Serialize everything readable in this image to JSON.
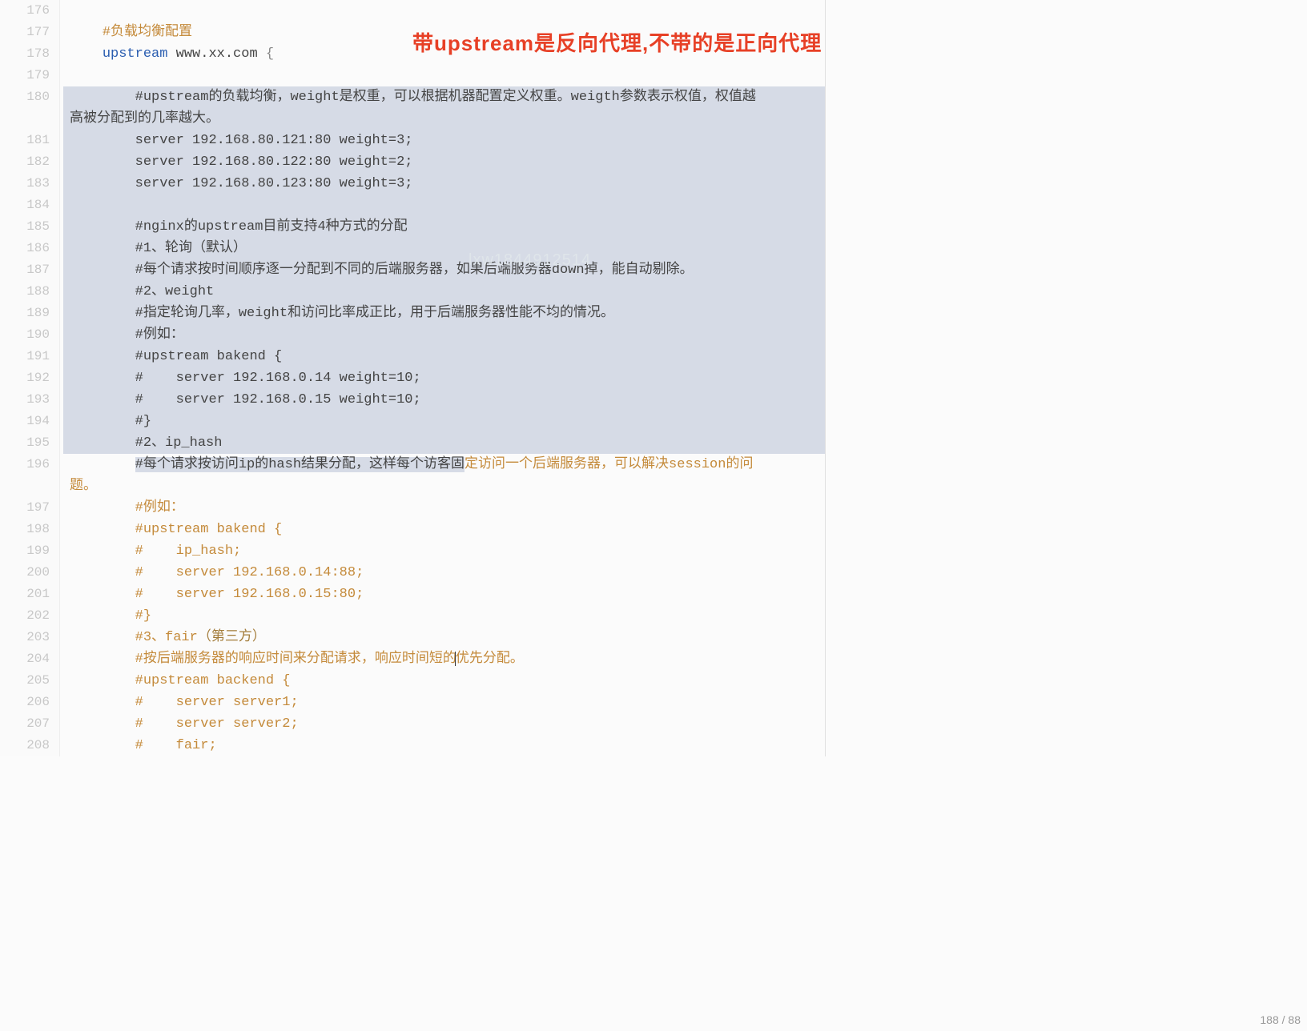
{
  "annotation": "带upstream是反向代理,不带的是正向代理",
  "watermark": "lxw1844912514",
  "status": "188 / 88",
  "gutter_start": 176,
  "lines": {
    "l176": "",
    "l177_a": "#负载均衡配置",
    "l178_kw": "upstream",
    "l178_host": " www.xx.com ",
    "l178_brace": "{",
    "l179": "",
    "l180_a": "#upstream的负载均衡，weight是权重，可以根据机器配置定义权重。weigth参数表示权值，权值越",
    "l180_b": "高被分配到的几率越大。",
    "l181": "server 192.168.80.121:80 weight=3;",
    "l182": "server 192.168.80.122:80 weight=2;",
    "l183": "server 192.168.80.123:80 weight=3;",
    "l184": "",
    "l185": "#nginx的upstream目前支持4种方式的分配",
    "l186": "#1、轮询（默认）",
    "l187": "#每个请求按时间顺序逐一分配到不同的后端服务器，如果后端服务器down掉，能自动剔除。",
    "l188": "#2、weight",
    "l189": "#指定轮询几率，weight和访问比率成正比，用于后端服务器性能不均的情况。",
    "l190": "#例如：",
    "l191": "#upstream bakend {",
    "l192": "#    server 192.168.0.14 weight=10;",
    "l193": "#    server 192.168.0.15 weight=10;",
    "l194": "#}",
    "l195": "#2、ip_hash",
    "l196_a": "#每个请求按访问ip的hash结果分配，这样每个访客固",
    "l196_b": "定访问一个后端服务器，可以解决session的问",
    "l196_c": "题。",
    "l197": "#例如：",
    "l198": "#upstream bakend {",
    "l199": "#    ip_hash;",
    "l200": "#    server 192.168.0.14:88;",
    "l201": "#    server 192.168.0.15:80;",
    "l202": "#}",
    "l203_a": "#3、fair",
    "l203_b": "（第三方）",
    "l204_a": "#按后端服务器的响应时间来分配请求，响应时间短的",
    "l204_b": "优先分配。",
    "l205": "#upstream backend {",
    "l206": "#    server server1;",
    "l207": "#    server server2;",
    "l208": "#    fair;"
  }
}
